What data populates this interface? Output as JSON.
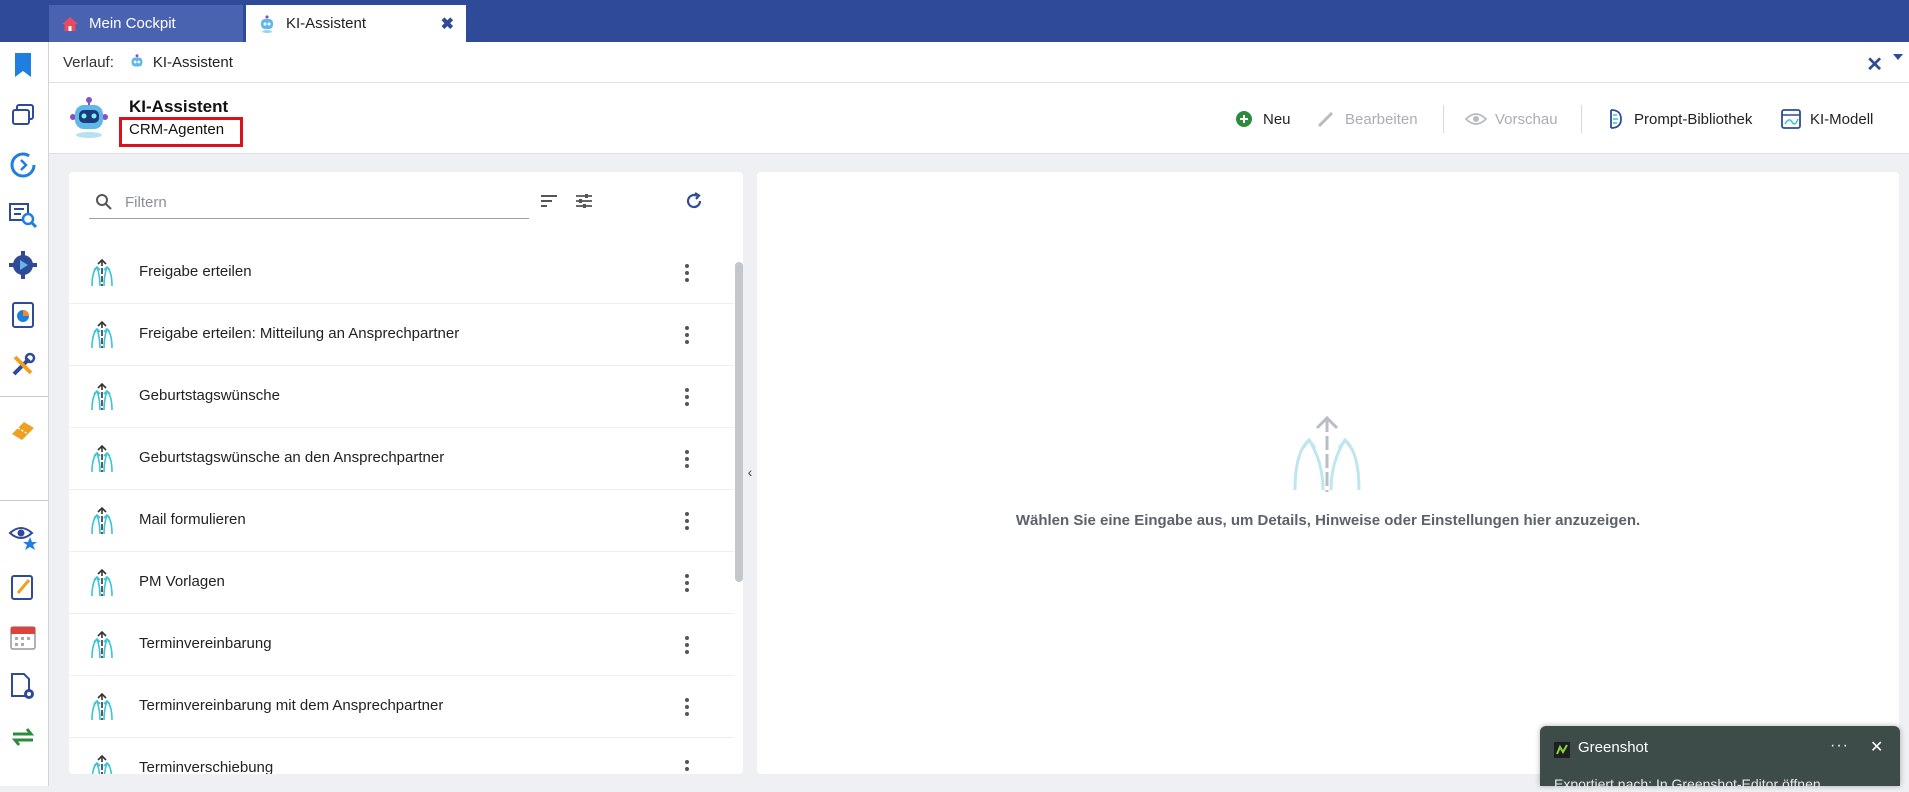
{
  "tabs": [
    {
      "label": "Mein Cockpit",
      "icon": "home-icon"
    },
    {
      "label": "KI-Assistent",
      "icon": "robot-icon",
      "close": "✖"
    }
  ],
  "breadcrumb": {
    "label": "Verlauf:",
    "item": "KI-Assistent"
  },
  "header": {
    "title": "KI-Assistent",
    "subtitle": "CRM-Agenten"
  },
  "toolbar": {
    "new_label": "Neu",
    "edit_label": "Bearbeiten",
    "preview_label": "Vorschau",
    "prompt_library_label": "Prompt-Bibliothek",
    "ai_model_label": "KI-Modell"
  },
  "filter": {
    "placeholder": "Filtern"
  },
  "list": {
    "items": [
      "Freigabe erteilen",
      "Freigabe erteilen: Mitteilung an Ansprechpartner",
      "Geburtstagswünsche",
      "Geburtstagswünsche an den Ansprechpartner",
      "Mail formulieren",
      "PM Vorlagen",
      "Terminvereinbarung",
      "Terminvereinbarung mit dem Ansprechpartner",
      "Terminverschiebung"
    ]
  },
  "detail": {
    "empty_text": "Wählen Sie eine Eingabe aus, um Details, Hinweise oder Einstellungen hier anzuzeigen."
  },
  "toast": {
    "title": "Greenshot",
    "more": "···",
    "close": "✕",
    "body_clipped": "Exportiert nach: In Greenshot-Editor öffnen"
  },
  "colors": {
    "tabbar": "#2f4a99",
    "accent": "#2f4a99",
    "highlight": "#d9121c",
    "new_green": "#2e8b3d",
    "agent_icon": "#3cc3d6"
  }
}
